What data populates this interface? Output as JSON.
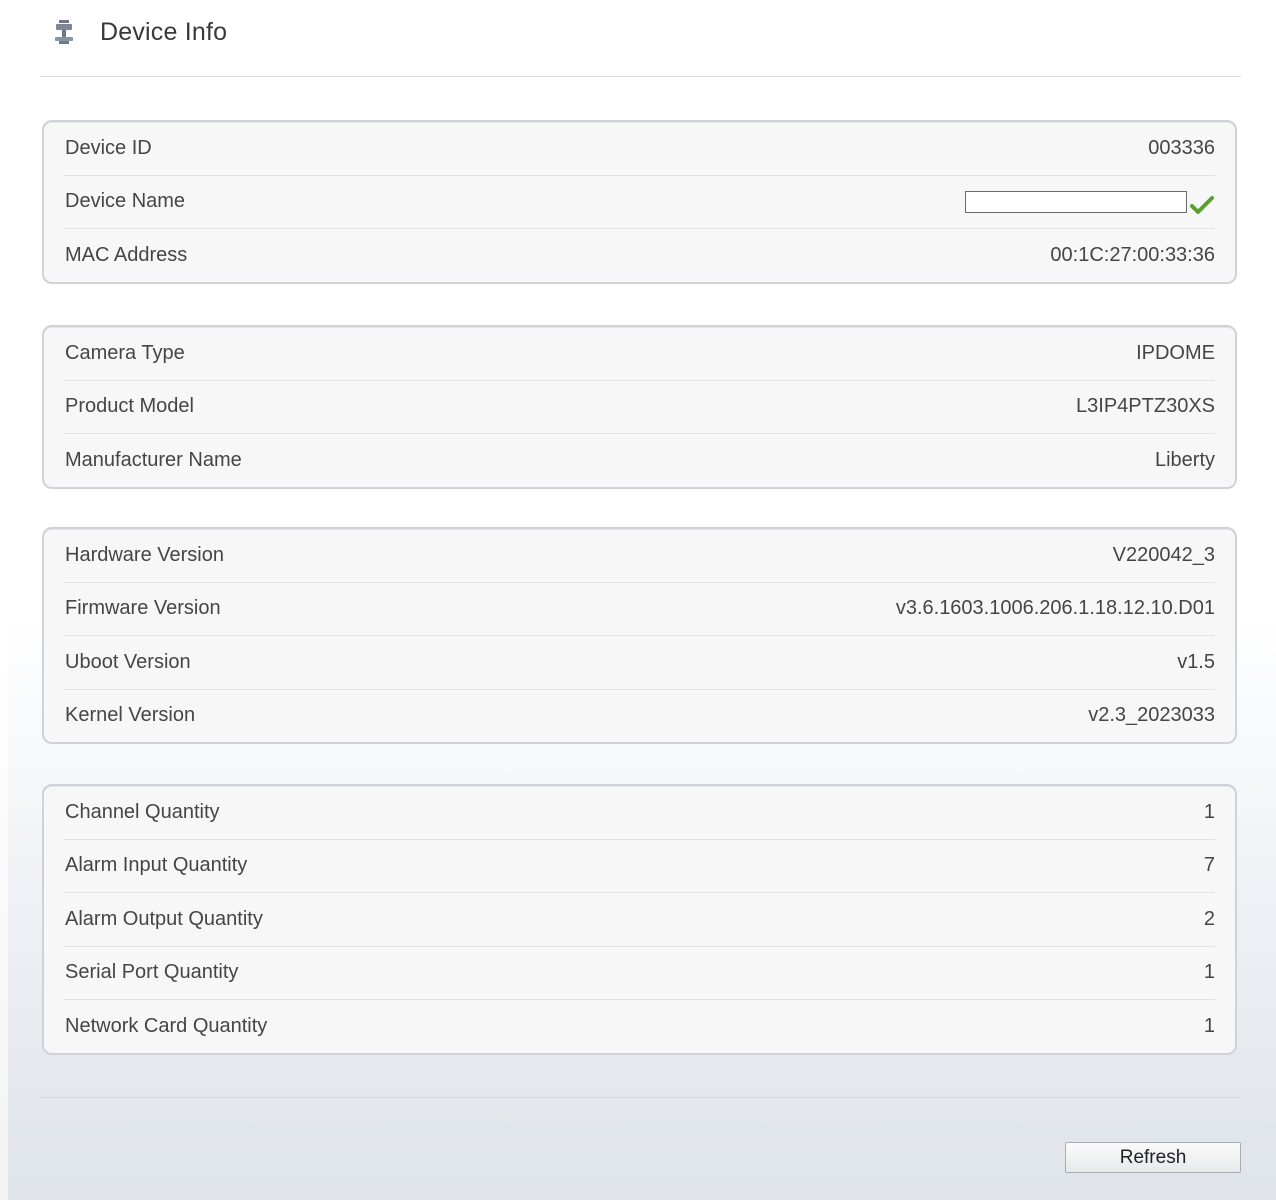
{
  "header": {
    "title": "Device Info",
    "icon": "device-info-icon"
  },
  "groups": [
    {
      "rows": [
        {
          "label": "Device ID",
          "value": "003336"
        },
        {
          "label": "Device Name",
          "value": ""
        },
        {
          "label": "MAC Address",
          "value": "00:1C:27:00:33:36"
        }
      ]
    },
    {
      "rows": [
        {
          "label": "Camera Type",
          "value": "IPDOME"
        },
        {
          "label": "Product Model",
          "value": "L3IP4PTZ30XS"
        },
        {
          "label": "Manufacturer Name",
          "value": "Liberty"
        }
      ]
    },
    {
      "rows": [
        {
          "label": "Hardware Version",
          "value": "V220042_3"
        },
        {
          "label": "Firmware Version",
          "value": "v3.6.1603.1006.206.1.18.12.10.D01"
        },
        {
          "label": "Uboot Version",
          "value": "v1.5"
        },
        {
          "label": "Kernel Version",
          "value": "v2.3_2023033"
        }
      ]
    },
    {
      "rows": [
        {
          "label": "Channel Quantity",
          "value": "1"
        },
        {
          "label": "Alarm Input Quantity",
          "value": "7"
        },
        {
          "label": "Alarm Output Quantity",
          "value": "2"
        },
        {
          "label": "Serial Port Quantity",
          "value": "1"
        },
        {
          "label": "Network Card Quantity",
          "value": "1"
        }
      ]
    }
  ],
  "actions": {
    "refresh_label": "Refresh"
  },
  "colors": {
    "check": "#5aa02c",
    "border": "#cfd3d8"
  }
}
